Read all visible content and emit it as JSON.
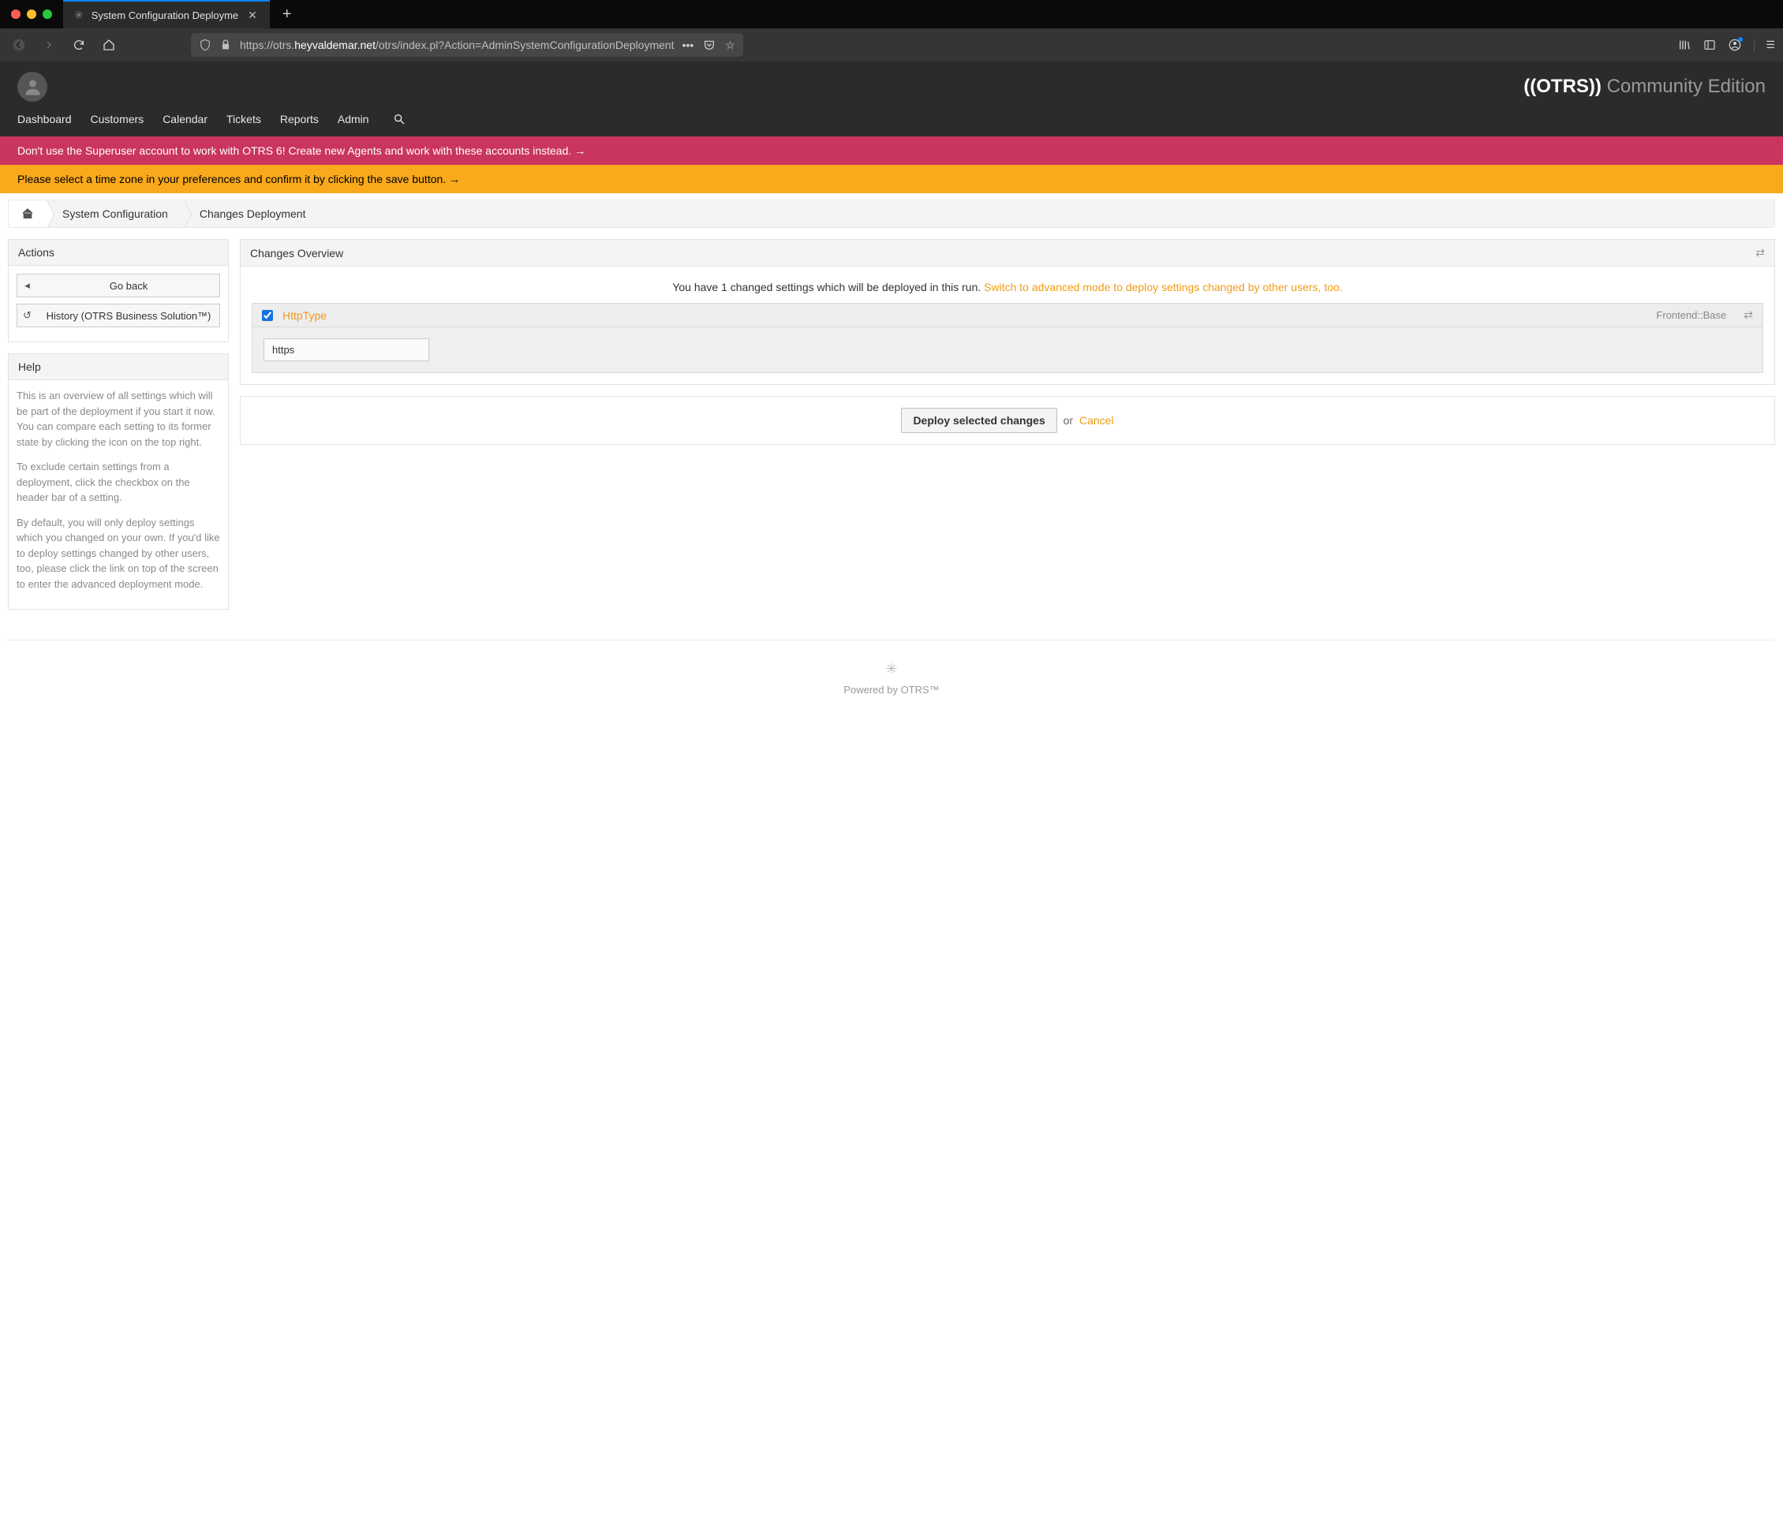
{
  "browser": {
    "tab_title": "System Configuration Deployme",
    "url_prefix": "https://otrs.",
    "url_domain": "heyvaldemar.net",
    "url_path": "/otrs/index.pl?Action=AdminSystemConfigurationDeployment"
  },
  "header": {
    "brand_bold": "((OTRS))",
    "brand_light": "Community Edition",
    "nav": [
      "Dashboard",
      "Customers",
      "Calendar",
      "Tickets",
      "Reports",
      "Admin"
    ]
  },
  "alerts": {
    "red": "Don't use the Superuser account to work with OTRS 6! Create new Agents and work with these accounts instead.",
    "yellow": "Please select a time zone in your preferences and confirm it by clicking the save button."
  },
  "breadcrumbs": {
    "b1": "System Configuration",
    "b2": "Changes Deployment"
  },
  "sidebar": {
    "actions_title": "Actions",
    "go_back": "Go back",
    "history": "History (OTRS Business Solution™)",
    "help_title": "Help",
    "help_p1": "This is an overview of all settings which will be part of the deployment if you start it now. You can compare each setting to its former state by clicking the icon on the top right.",
    "help_p2": "To exclude certain settings from a deployment, click the checkbox on the header bar of a setting.",
    "help_p3": "By default, you will only deploy settings which you changed on your own. If you'd like to deploy settings changed by other users, too, please click the link on top of the screen to enter the advanced deployment mode."
  },
  "main": {
    "overview_title": "Changes Overview",
    "notice_text": "You have 1 changed settings which will be deployed in this run. ",
    "notice_link": "Switch to advanced mode to deploy settings changed by other users, too.",
    "setting": {
      "name": "HttpType",
      "category": "Frontend::Base",
      "value": "https"
    },
    "deploy_btn": "Deploy selected changes",
    "or": "or",
    "cancel": "Cancel"
  },
  "footer": "Powered by OTRS™"
}
